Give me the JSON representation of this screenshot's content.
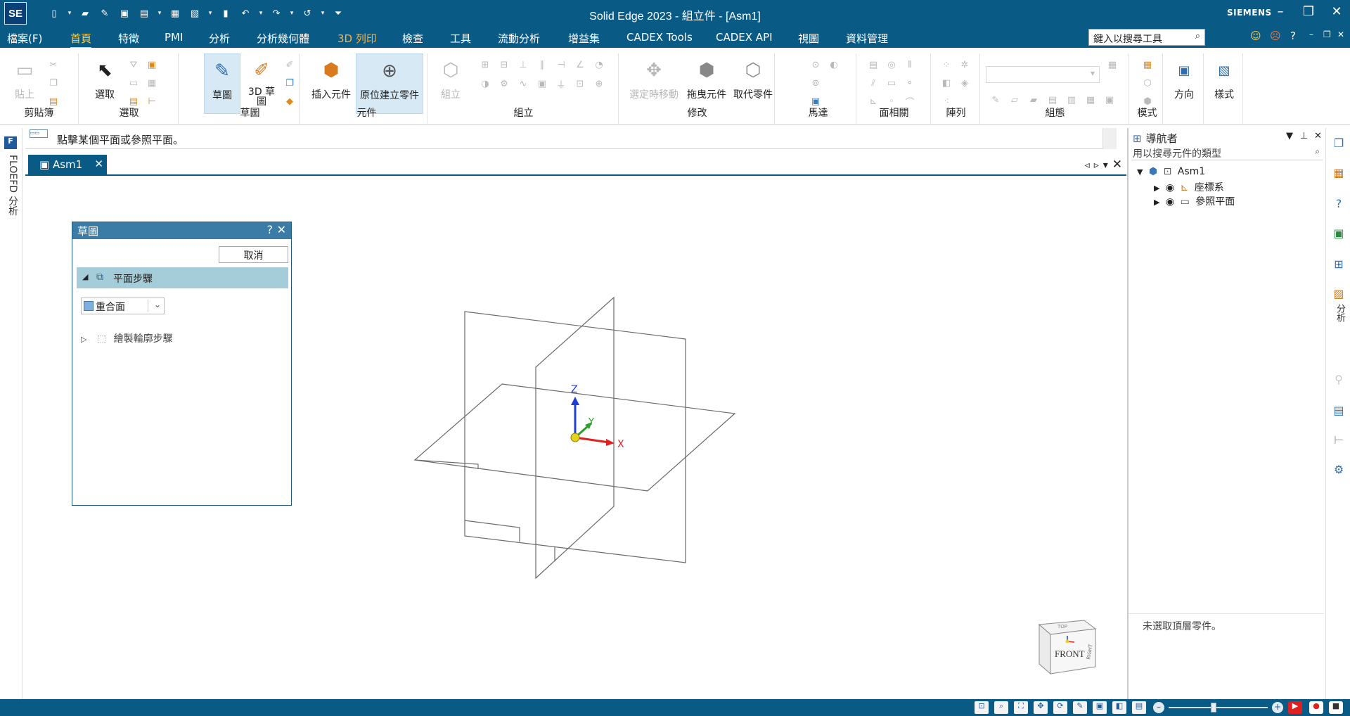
{
  "app": {
    "logo": "SE",
    "title": "Solid Edge 2023 - 組立件 - [Asm1]",
    "brand": "SIEMENS"
  },
  "menu": {
    "items": [
      "檔案(F)",
      "首頁",
      "特徵",
      "PMI",
      "分析",
      "分析幾何體",
      "3D 列印",
      "檢查",
      "工具",
      "流動分析",
      "增益集",
      "CADEX Tools",
      "CADEX API",
      "視圖",
      "資料管理"
    ],
    "active": "首頁",
    "search_placeholder": "鍵入以搜尋工具",
    "help": "?"
  },
  "ribbon": {
    "clipboard": {
      "paste": "貼上",
      "group": "剪貼簿"
    },
    "select": {
      "select": "選取",
      "group": "選取"
    },
    "sketch": {
      "sketch": "草圖",
      "sketch3d": "3D 草圖",
      "group": "草圖"
    },
    "component": {
      "insert": "插入元件",
      "create_in_place": "原位建立零件",
      "group": "元件"
    },
    "assemble": {
      "assemble": "組立",
      "group": "組立"
    },
    "modify": {
      "select_move": "選定時移動",
      "drag": "拖曳元件",
      "replace": "取代零件",
      "group": "修改"
    },
    "motor": {
      "group": "馬達"
    },
    "face_relate": {
      "group": "面相關"
    },
    "pattern": {
      "group": "陣列"
    },
    "configuration": {
      "group": "組態"
    },
    "style": {
      "group": "樣式",
      "style": "樣式"
    },
    "orient": {
      "group": "模式",
      "orient": "方向"
    }
  },
  "prompt": {
    "text": "點擊某個平面或參照平面。"
  },
  "left_strip": {
    "label": "FLOEFD 分析"
  },
  "document_tabs": [
    {
      "label": "Asm1"
    }
  ],
  "dialog": {
    "title": "草圖",
    "help": "?",
    "cancel": "取消",
    "step1": "平面步驟",
    "plane_option": "重合面",
    "step2": "繪製輪廓步驟"
  },
  "axes": {
    "x": "X",
    "y": "Y",
    "z": "Z"
  },
  "viewcube": {
    "front": "FRONT",
    "top": "TOP",
    "right": "RIGHT"
  },
  "navigator": {
    "title": "導航者",
    "search_placeholder": "用以搜尋元件的類型",
    "tree": [
      {
        "label": "Asm1",
        "level": 0,
        "expanded": true
      },
      {
        "label": "座標系",
        "level": 1,
        "expanded": false
      },
      {
        "label": "參照平面",
        "level": 1,
        "expanded": false
      }
    ],
    "status": "未選取頂層零件。"
  },
  "right_strip": {
    "label": "分析"
  },
  "colors": {
    "accent": "#0a5a86",
    "active_tab": "#ffd24a",
    "dialog_step": "#a4cdd9",
    "x_axis": "#e02020",
    "y_axis": "#2aa02a",
    "z_axis": "#1f3fd0"
  }
}
